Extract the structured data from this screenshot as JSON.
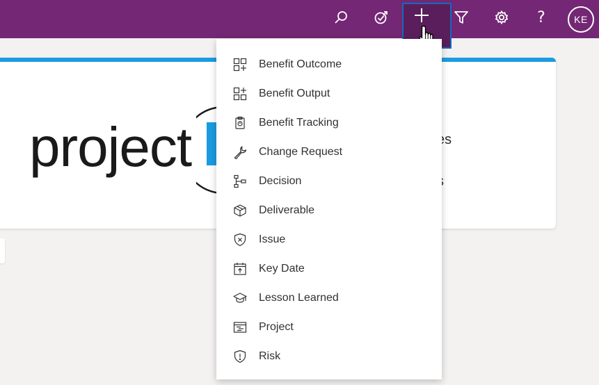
{
  "topbar": {
    "color": "#742774",
    "icons": [
      "search-icon",
      "goal-icon",
      "add-icon",
      "filter-icon",
      "settings-icon",
      "help-icon"
    ],
    "help_label": "?",
    "user_initials": "KE"
  },
  "card": {
    "logo_text": "project",
    "text_1": "es",
    "text_2": "s",
    "accent": "#1a9ce0"
  },
  "new_menu": {
    "items": [
      {
        "label": "Benefit Outcome",
        "icon": "benefit-outcome-icon"
      },
      {
        "label": "Benefit Output",
        "icon": "benefit-output-icon"
      },
      {
        "label": "Benefit Tracking",
        "icon": "benefit-tracking-icon"
      },
      {
        "label": "Change Request",
        "icon": "wrench-icon"
      },
      {
        "label": "Decision",
        "icon": "decision-icon"
      },
      {
        "label": "Deliverable",
        "icon": "box-icon"
      },
      {
        "label": "Issue",
        "icon": "shield-x-icon"
      },
      {
        "label": "Key Date",
        "icon": "calendar-icon"
      },
      {
        "label": "Lesson Learned",
        "icon": "graduation-cap-icon"
      },
      {
        "label": "Project",
        "icon": "project-icon"
      },
      {
        "label": "Risk",
        "icon": "shield-alert-icon"
      }
    ]
  }
}
